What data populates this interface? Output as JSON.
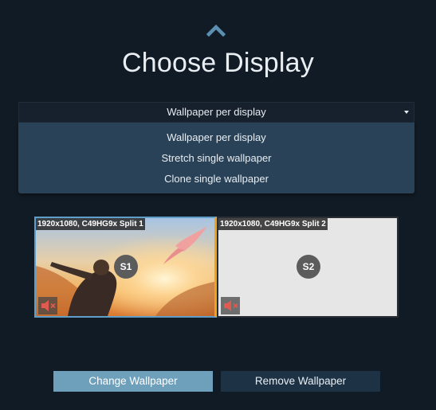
{
  "header": {
    "title": "Choose Display",
    "collapse_icon": "chevron-up-icon"
  },
  "mode_select": {
    "selected": "Wallpaper per display",
    "options": [
      "Wallpaper per display",
      "Stretch single wallpaper",
      "Clone single wallpaper"
    ]
  },
  "displays": [
    {
      "label": "1920x1080, C49HG9x Split 1",
      "badge": "S1",
      "has_wallpaper": true,
      "selected": true,
      "mute_icon": "speaker-muted-icon"
    },
    {
      "label": "1920x1080, C49HG9x Split 2",
      "badge": "S2",
      "has_wallpaper": false,
      "selected": false,
      "mute_icon": "speaker-muted-icon"
    }
  ],
  "actions": {
    "change_label": "Change Wallpaper",
    "remove_label": "Remove Wallpaper"
  },
  "colors": {
    "background": "#111b25",
    "dropdown": "#2a4257",
    "primary_button": "#6e9fbb",
    "secondary_button": "#1d3245",
    "selected_border": "#5e9ec8",
    "active_accent": "#f0a21a"
  }
}
